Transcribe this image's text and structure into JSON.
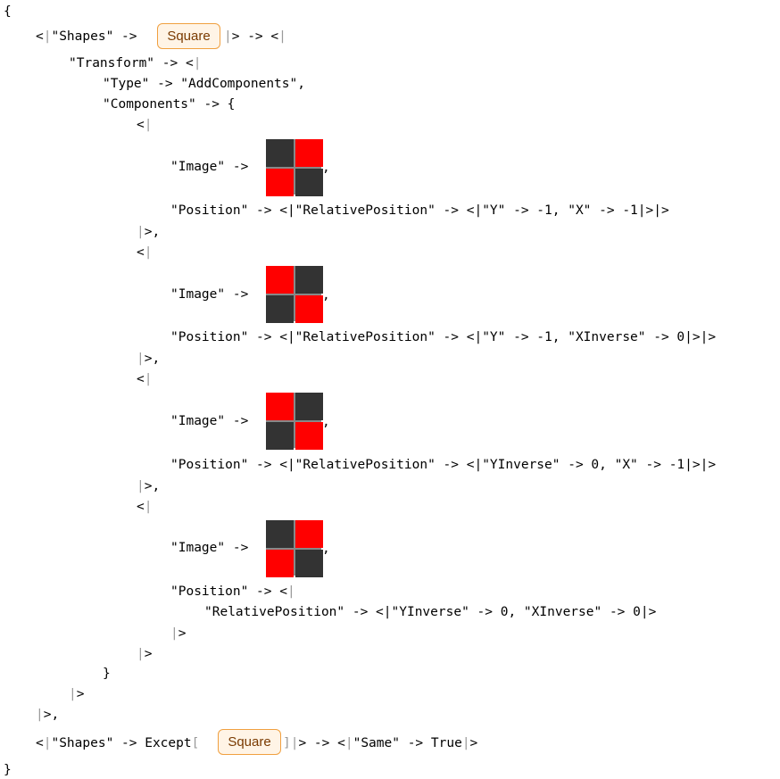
{
  "text": {
    "open_brace": "{",
    "close_brace": "}",
    "rule1_pre": "<",
    "rule1_shapes_key": "\"Shapes\" -> ",
    "rule1_chip": "Square",
    "rule1_post": "> -> <",
    "transform_line": "\"Transform\" -> <",
    "type_line": "\"Type\" -> \"AddComponents\",",
    "components_line": "\"Components\" -> {",
    "assoc_open": "<",
    "image_key": "\"Image\" -> ",
    "comma": ",",
    "pos1": "\"Position\" -> <|\"RelativePosition\" -> <|\"Y\" -> -1, \"X\" -> -1|>|>",
    "pos2": "\"Position\" -> <|\"RelativePosition\" -> <|\"Y\" -> -1, \"XInverse\" -> 0|>|>",
    "pos3": "\"Position\" -> <|\"RelativePosition\" -> <|\"YInverse\" -> 0, \"X\" -> -1|>|>",
    "pos4_a": "\"Position\" -> <",
    "pos4_b": "\"RelativePosition\" -> <|\"YInverse\" -> 0, \"XInverse\" -> 0|>",
    "assoc_close_comma": ">,",
    "assoc_close": ">",
    "close_curly": "}",
    "rule1_close": ">,",
    "rule2_pre": "<|\"Shapes\" -> Except[",
    "rule2_chip": "Square",
    "rule2_post": "]|> -> <|\"Same\" -> True|>"
  },
  "images": [
    [
      "#333333",
      "#ff0000",
      "#ff0000",
      "#333333"
    ],
    [
      "#ff0000",
      "#333333",
      "#333333",
      "#ff0000"
    ],
    [
      "#ff0000",
      "#333333",
      "#333333",
      "#ff0000"
    ],
    [
      "#333333",
      "#ff0000",
      "#ff0000",
      "#333333"
    ]
  ],
  "colors": {
    "dark": "#333333",
    "red": "#ff0000",
    "chip_border": "#f0a040",
    "chip_bg": "#fff4e6"
  }
}
